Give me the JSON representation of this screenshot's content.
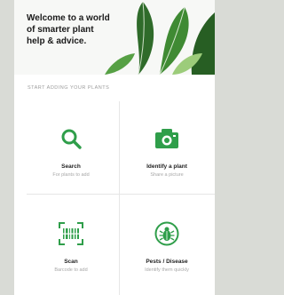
{
  "welcome": {
    "line1": "Welcome to a world",
    "line2": "of smarter plant",
    "line3": "help & advice."
  },
  "section_heading": "START ADDING YOUR PLANTS",
  "actions": [
    {
      "label": "Search",
      "subtitle": "For plants to add",
      "icon": "search-icon"
    },
    {
      "label": "Identify a plant",
      "subtitle": "Share a picture",
      "icon": "camera-icon"
    },
    {
      "label": "Scan",
      "subtitle": "Barcode to add",
      "icon": "barcode-scan-icon"
    },
    {
      "label": "Pests / Disease",
      "subtitle": "Identify them quickly",
      "icon": "bug-icon"
    }
  ],
  "colors": {
    "accent": "#2f9e4a",
    "background": "#ffffff",
    "muted_text": "#a8a8a8"
  }
}
